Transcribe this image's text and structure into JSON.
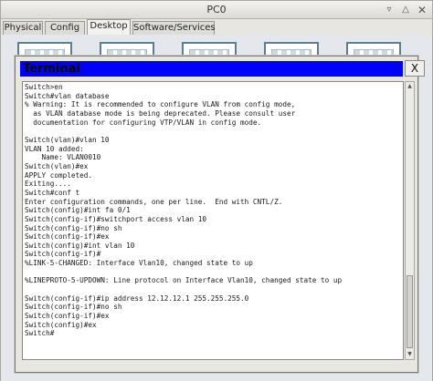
{
  "window": {
    "title": "PC0"
  },
  "tabs": [
    {
      "label": "Physical"
    },
    {
      "label": "Config"
    },
    {
      "label": "Desktop"
    },
    {
      "label": "Software/Services"
    }
  ],
  "terminal": {
    "title": "Terminal",
    "close_label": "X",
    "lines": [
      "Switch>en",
      "Switch#vlan database",
      "% Warning: It is recommended to configure VLAN from config mode,",
      "  as VLAN database mode is being deprecated. Please consult user",
      "  documentation for configuring VTP/VLAN in config mode.",
      "",
      "Switch(vlan)#vlan 10",
      "VLAN 10 added:",
      "    Name: VLAN0010",
      "Switch(vlan)#ex",
      "APPLY completed.",
      "Exiting....",
      "Switch#conf t",
      "Enter configuration commands, one per line.  End with CNTL/Z.",
      "Switch(config)#int fa 0/1",
      "Switch(config-if)#switchport access vlan 10",
      "Switch(config-if)#no sh",
      "Switch(config-if)#ex",
      "Switch(config)#int vlan 10",
      "Switch(config-if)#",
      "%LINK-5-CHANGED: Interface Vlan10, changed state to up",
      "",
      "%LINEPROTO-5-UPDOWN: Line protocol on Interface Vlan10, changed state to up",
      "",
      "Switch(config-if)#ip address 12.12.12.1 255.255.255.0",
      "Switch(config-if)#no sh",
      "Switch(config-if)#ex",
      "Switch(config)#ex",
      "Switch#"
    ]
  },
  "colors": {
    "terminal_title_bar": "#0000ff",
    "window_bg": "#e8e6e1",
    "console_bg": "#ffffff"
  }
}
